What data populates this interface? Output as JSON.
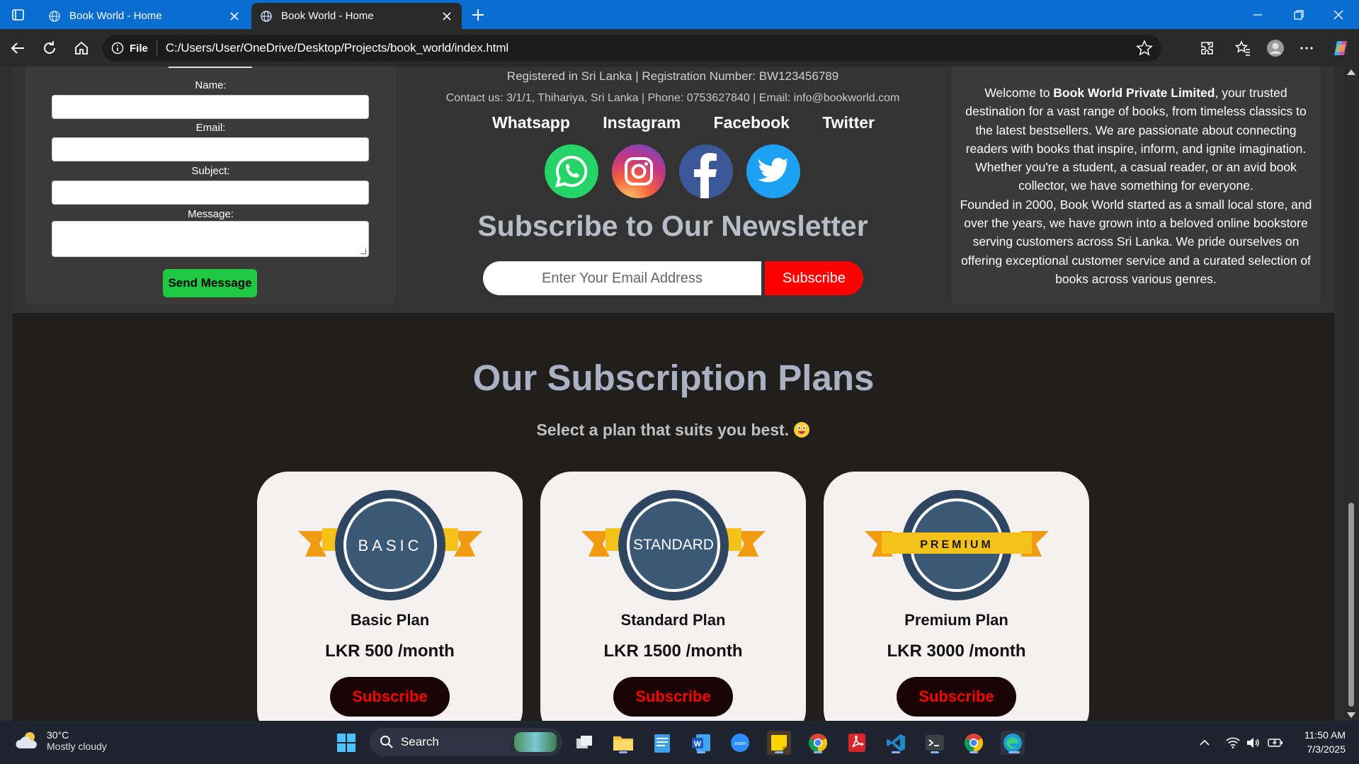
{
  "browser": {
    "tabs": [
      {
        "title": "Book World - Home",
        "active": false
      },
      {
        "title": "Book World - Home",
        "active": true
      }
    ],
    "address": {
      "protocol": "File",
      "url": "C:/Users/User/OneDrive/Desktop/Projects/book_world/index.html"
    }
  },
  "contact_form": {
    "name_label": "Name:",
    "email_label": "Email:",
    "subject_label": "Subject:",
    "message_label": "Message:",
    "send_label": "Send Message"
  },
  "company": {
    "registration": "Registered in Sri Lanka | Registration Number: BW123456789",
    "contact": "Contact us: 3/1/1, Thihariya, Sri Lanka | Phone: 0753627840 | Email: info@bookworld.com",
    "social_links": [
      "Whatsapp",
      "Instagram",
      "Facebook",
      "Twitter"
    ],
    "social_colors": {
      "whatsapp": "#25d366",
      "facebook": "#3b5998",
      "twitter": "#1da1f2"
    }
  },
  "newsletter": {
    "title": "Subscribe to Our Newsletter",
    "placeholder": "Enter Your Email Address",
    "button": "Subscribe"
  },
  "about": {
    "intro": "Welcome to ",
    "company_name": "Book World Private Limited",
    "para1_rest": ", your trusted destination for a vast range of books, from timeless classics to the latest bestsellers. We are passionate about connecting readers with books that inspire, inform, and ignite imagination. Whether you're a student, a casual reader, or an avid book collector, we have something for everyone.",
    "para2": "Founded in 2000, Book World started as a small local store, and over the years, we have grown into a beloved online bookstore serving customers across Sri Lanka. We pride ourselves on offering exceptional customer service and a curated selection of books across various genres."
  },
  "plans": {
    "title": "Our Subscription Plans",
    "subtitle": "Select a plan that suits you best.",
    "items": [
      {
        "badge": "BASIC",
        "name": "Basic Plan",
        "price": "LKR 500 /month",
        "button": "Subscribe"
      },
      {
        "badge": "STANDARD",
        "name": "Standard Plan",
        "price": "LKR 1500 /month",
        "button": "Subscribe"
      },
      {
        "badge": "PREMIUM",
        "name": "Premium Plan",
        "price": "LKR 3000 /month",
        "button": "Subscribe"
      }
    ]
  },
  "taskbar": {
    "weather_temp": "30°C",
    "weather_desc": "Mostly cloudy",
    "search_label": "Search",
    "time": "11:50 AM",
    "date": "7/3/2025"
  }
}
